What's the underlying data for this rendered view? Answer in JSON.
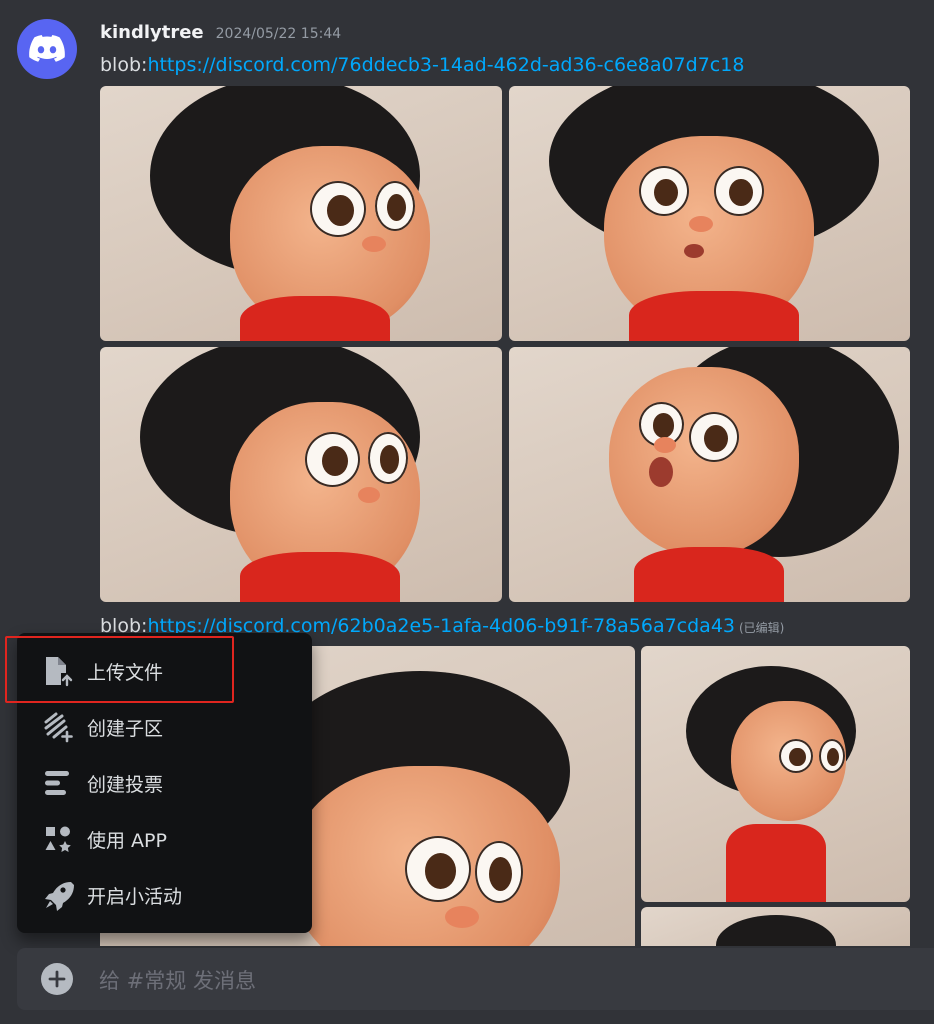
{
  "message": {
    "username": "kindlytree",
    "timestamp": "2024/05/22 15:44",
    "line1_prefix": "blob:",
    "line1_link": "https://discord.com/76ddecb3-14ad-462d-ad36-c6e8a07d7c18",
    "line2_prefix": "blob:",
    "line2_link": "https://discord.com/62b0a2e5-1afa-4d06-b91f-78a56a7cda43",
    "edited": "(已编辑)"
  },
  "menu": {
    "items": [
      {
        "label": "上传文件",
        "icon": "upload-file-icon"
      },
      {
        "label": "创建子区",
        "icon": "create-thread-icon"
      },
      {
        "label": "创建投票",
        "icon": "create-poll-icon"
      },
      {
        "label": "使用 APP",
        "icon": "use-app-icon"
      },
      {
        "label": "开启小活动",
        "icon": "rocket-icon"
      }
    ],
    "highlight_color": "#e0251f"
  },
  "composer": {
    "placeholder": "给 #常规 发消息"
  },
  "colors": {
    "background": "#313338",
    "link": "#00a8fc",
    "menu_bg": "#111214",
    "avatar_bg": "#5865f2",
    "composer_bg": "#383a40"
  }
}
